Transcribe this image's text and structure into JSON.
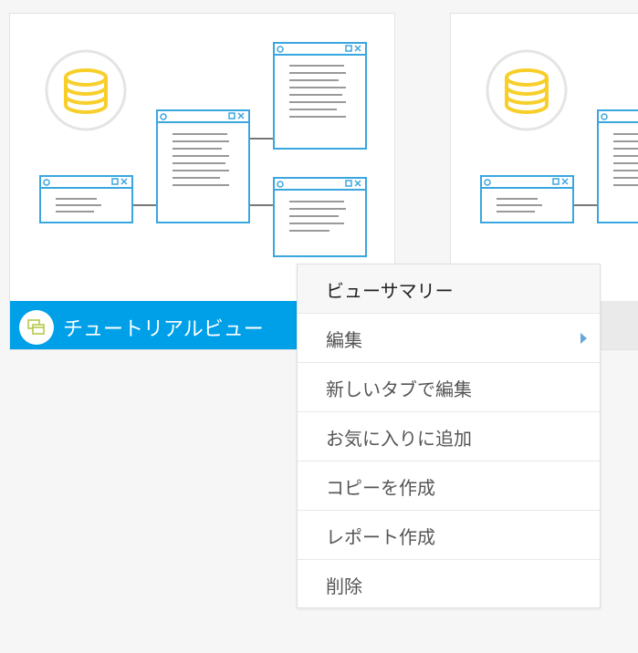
{
  "cards": [
    {
      "title": "チュートリアルビュー",
      "icon": "view-icon"
    },
    {
      "title": "",
      "icon": "view-icon"
    }
  ],
  "context_menu": {
    "header": "ビューサマリー",
    "items": [
      {
        "label": "編集",
        "has_submenu": true
      },
      {
        "label": "新しいタブで編集"
      },
      {
        "label": "お気に入りに追加"
      },
      {
        "label": "コピーを作成"
      },
      {
        "label": "レポート作成"
      },
      {
        "label": "削除"
      }
    ]
  },
  "colors": {
    "accent": "#00a0e9",
    "database": "#f8cf2a",
    "window_line": "#3aa6df"
  }
}
